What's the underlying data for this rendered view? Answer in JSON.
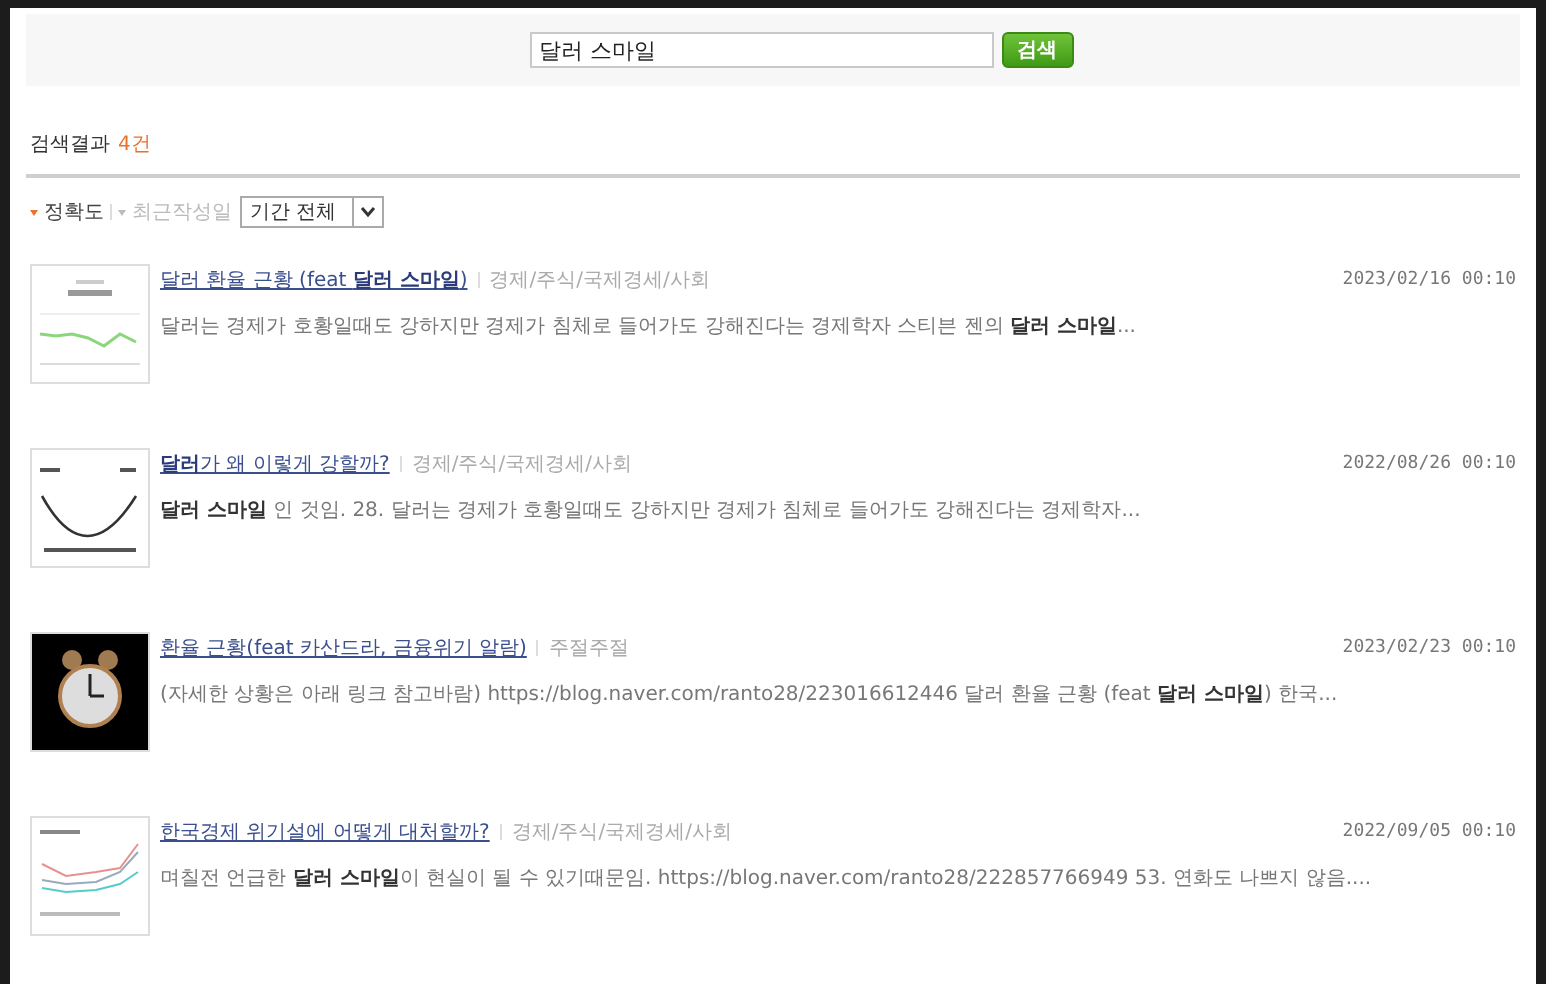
{
  "search": {
    "value": "달러 스마일",
    "button": "검색"
  },
  "results_header": {
    "label": "검색결과",
    "count": "4건"
  },
  "sort_options": [
    {
      "label": "정확도",
      "selected": true
    },
    {
      "label": "최근작성일",
      "selected": false
    }
  ],
  "period_select": {
    "value": "기간 전체"
  },
  "results": [
    {
      "kind": "chart",
      "title": "달러 환율 근황 (feat **달러 스마일**)",
      "category": "경제/주식/국제경세/사회",
      "date": "2023/02/16 00:10",
      "snippet": "달러는 경제가 호황일때도 강하지만 경제가 침체로 들어가도 강해진다는 경제학자 스티븐 젠의 **달러 스마일**..."
    },
    {
      "kind": "curve",
      "title": "**달러**가 왜 이렇게 강할까?",
      "category": "경제/주식/국제경세/사회",
      "date": "2022/08/26 00:10",
      "snippet": "**달러 스마일** 인 것임. 28. 달러는 경제가 호황일때도 강하지만 경제가 침체로 들어가도 강해진다는 경제학자..."
    },
    {
      "kind": "photo",
      "title": "환율 근황(feat 카산드라, 금융위기 알람)",
      "category": "주절주절",
      "date": "2023/02/23 00:10",
      "snippet": "(자세한 상황은 아래 링크 참고바람) https://blog.naver.com/ranto28/223016612446 달러 환율 근황 (feat **달러 스마일**) 한국..."
    },
    {
      "kind": "lines",
      "title": "한국경제 위기설에 어떻게 대처할까?",
      "category": "경제/주식/국제경세/사회",
      "date": "2022/09/05 00:10",
      "snippet": "며칠전 언급한 **달러 스마일**이 현실이 될 수 있기때문임. https://blog.naver.com/ranto28/222857766949 53. 연화도 나쁘지 않음...."
    }
  ]
}
